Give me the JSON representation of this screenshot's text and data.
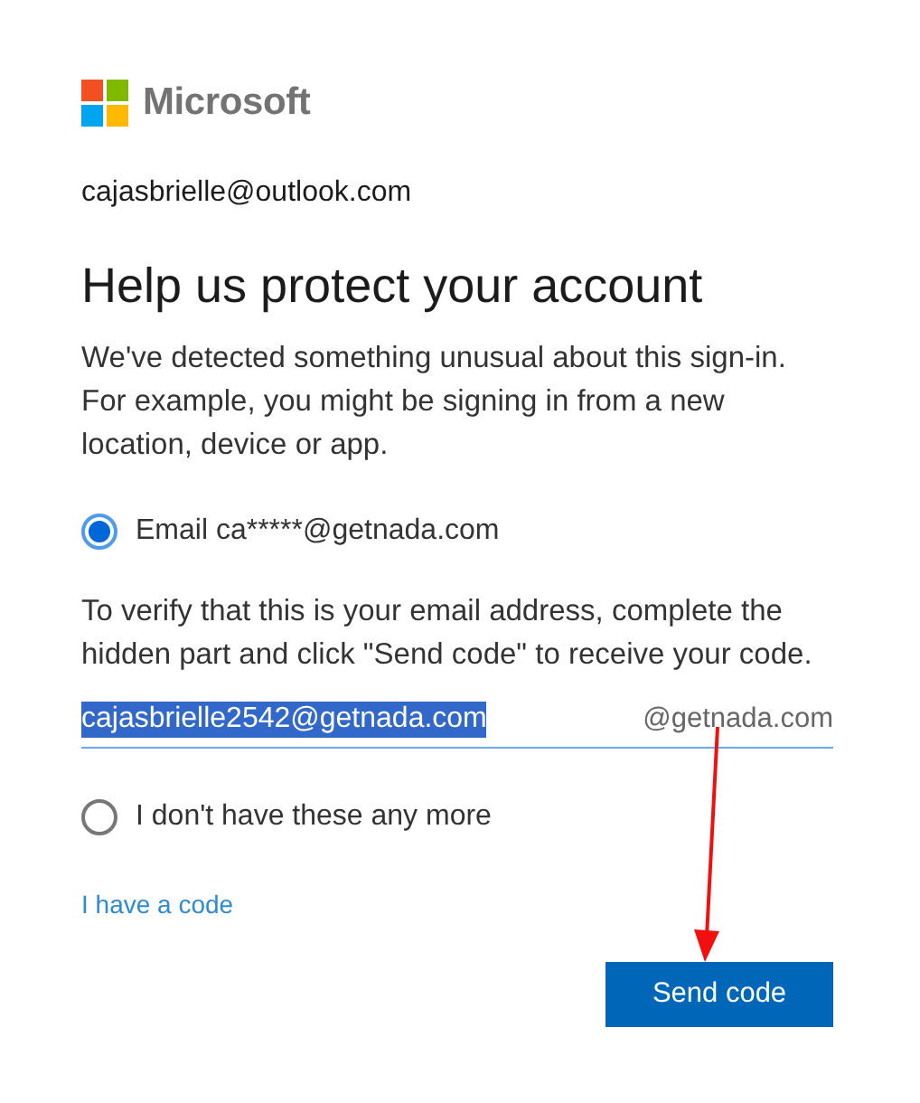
{
  "brand": {
    "name": "Microsoft"
  },
  "account": "cajasbrielle@outlook.com",
  "title": "Help us protect your account",
  "intro": "We've detected something unusual about this sign-in. For example, you might be signing in from a new location, device or app.",
  "options": [
    {
      "label": "Email ca*****@getnada.com",
      "selected": true
    },
    {
      "label": "I don't have these any more",
      "selected": false
    }
  ],
  "instructions": "To verify that this is your email address, complete the hidden part and click \"Send code\" to receive your code.",
  "email_field": {
    "value": "cajasbrielle2542@getnada.com",
    "value_highlighted": true,
    "suffix": "@getnada.com"
  },
  "link": "I have a code",
  "button": "Send code"
}
